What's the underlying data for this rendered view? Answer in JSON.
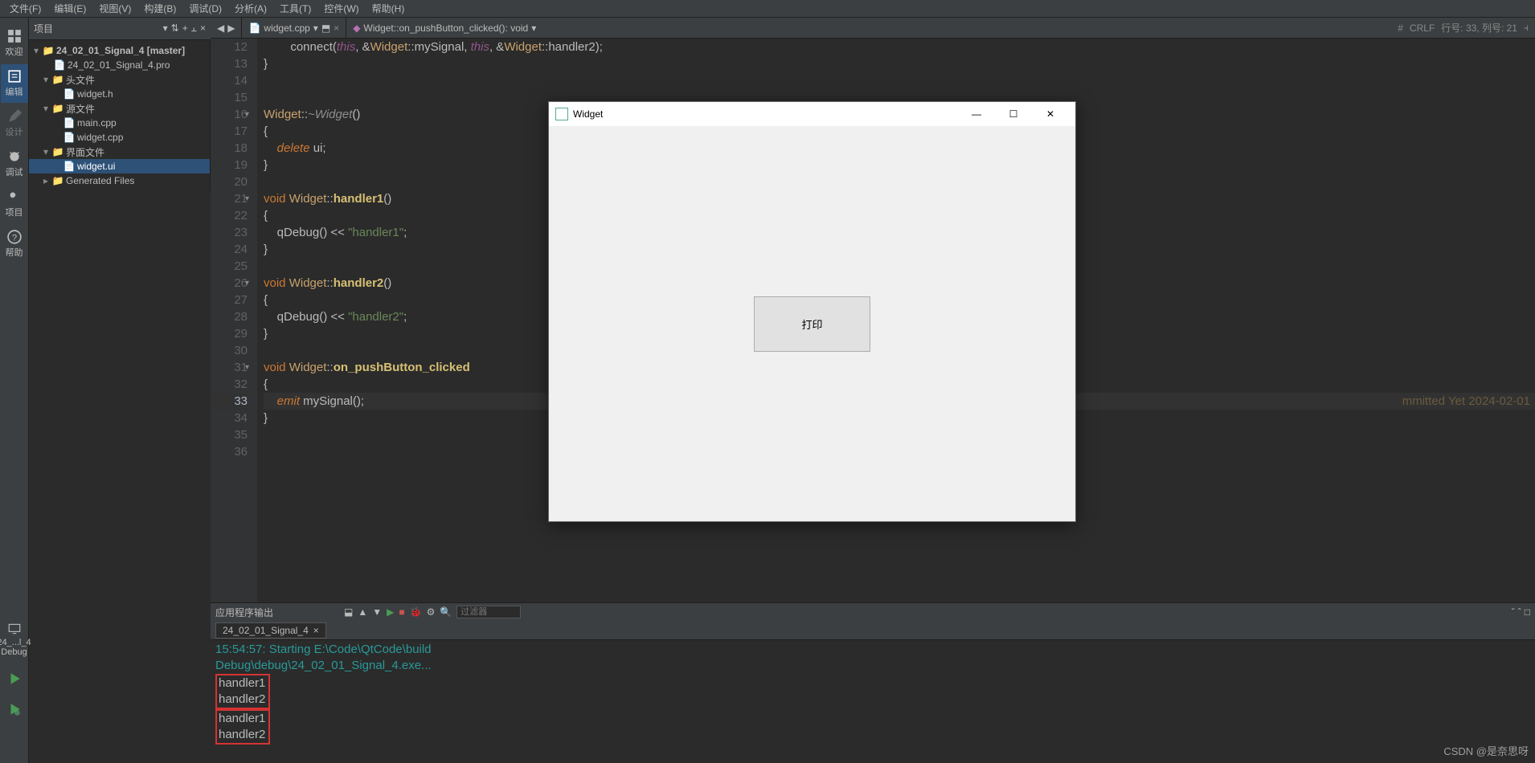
{
  "menu": {
    "file": "文件(F)",
    "edit": "编辑(E)",
    "view": "视图(V)",
    "build": "构建(B)",
    "debug": "调试(D)",
    "analyze": "分析(A)",
    "tools": "工具(T)",
    "widgets": "控件(W)",
    "help": "帮助(H)"
  },
  "sidebar": {
    "welcome": "欢迎",
    "edit": "编辑",
    "design": "设计",
    "debug": "调试",
    "project": "项目",
    "help": "帮助",
    "run_target": "24_...l_4",
    "debug_label": "Debug"
  },
  "project_header": {
    "title": "项目"
  },
  "tree": {
    "root": "24_02_01_Signal_4 [master]",
    "pro": "24_02_01_Signal_4.pro",
    "headers": "头文件",
    "widget_h": "widget.h",
    "sources": "源文件",
    "main_cpp": "main.cpp",
    "widget_cpp": "widget.cpp",
    "forms": "界面文件",
    "widget_ui": "widget.ui",
    "generated": "Generated Files"
  },
  "editor": {
    "tab_file": "widget.cpp",
    "crumb": "Widget::on_pushButton_clicked(): void",
    "hash_label": "#",
    "crlf": "CRLF",
    "cursor": "行号: 33, 列号: 21",
    "lines": {
      "12": "        connect(this, &Widget::mySignal, this, &Widget::handler2);",
      "13": "}",
      "14": "",
      "15": "",
      "16": "Widget::~Widget()",
      "17": "{",
      "18": "    delete ui;",
      "19": "}",
      "20": "",
      "21": "void Widget::handler1()",
      "22": "{",
      "23": "    qDebug() << \"handler1\";",
      "24": "}",
      "25": "",
      "26": "void Widget::handler2()",
      "27": "{",
      "28": "    qDebug() << \"handler2\";",
      "29": "}",
      "30": "",
      "31": "void Widget::on_pushButton_clicked()",
      "32": "{",
      "33": "    emit mySignal();",
      "34": "}",
      "35": "",
      "36": ""
    },
    "blame": "mmitted Yet 2024-02-01"
  },
  "output": {
    "title": "应用程序输出",
    "filter_placeholder": "过滤器",
    "tab": "24_02_01_Signal_4",
    "start": "15:54:57: Starting E:\\Code\\QtCode\\build",
    "start2": "Debug\\debug\\24_02_01_Signal_4.exe...",
    "h1": "handler1",
    "h2": "handler2",
    "h3": "handler1",
    "h4": "handler2"
  },
  "widget_window": {
    "title": "Widget",
    "button": "打印"
  },
  "watermark": "CSDN @是奈思呀"
}
